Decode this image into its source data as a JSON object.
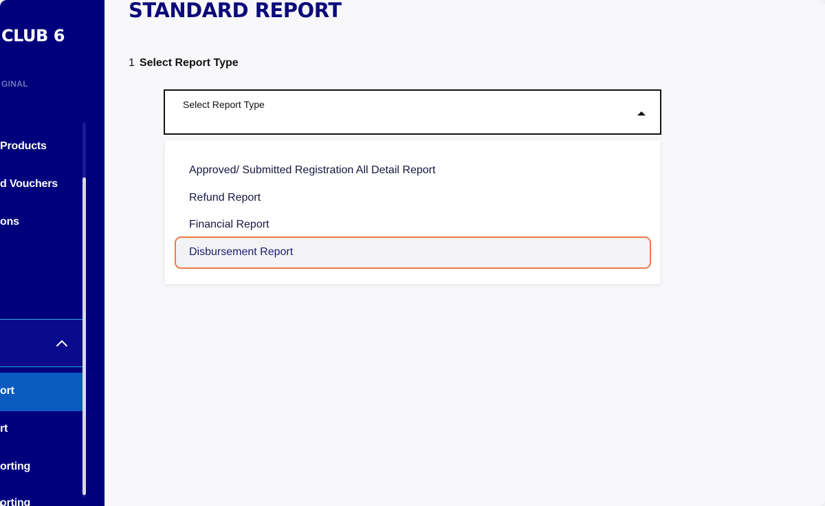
{
  "sidebar": {
    "brand": "CLUB 6",
    "sub_brand": "GINAL",
    "items": [
      {
        "label": "Products"
      },
      {
        "label": "d Vouchers"
      },
      {
        "label": "ons"
      }
    ],
    "active_item": "ort",
    "items_below": [
      {
        "label": "rt"
      },
      {
        "label": "orting"
      },
      {
        "label": "orting"
      }
    ]
  },
  "main": {
    "title": "STANDARD REPORT",
    "step_number": "1",
    "step_label": "Select Report Type",
    "select": {
      "caption": "Select Report Type",
      "open": true
    },
    "options": [
      {
        "label": "Approved/ Submitted Registration All Detail Report"
      },
      {
        "label": "Refund Report"
      },
      {
        "label": "Financial Report"
      },
      {
        "label": "Disbursement Report",
        "highlighted": true
      }
    ]
  },
  "colors": {
    "sidebar_bg": "#00007d",
    "active_bg": "#0a5bbf",
    "title": "#0b0a7a",
    "highlight_border": "#ef7a49",
    "group_border": "#1fb2e3"
  }
}
